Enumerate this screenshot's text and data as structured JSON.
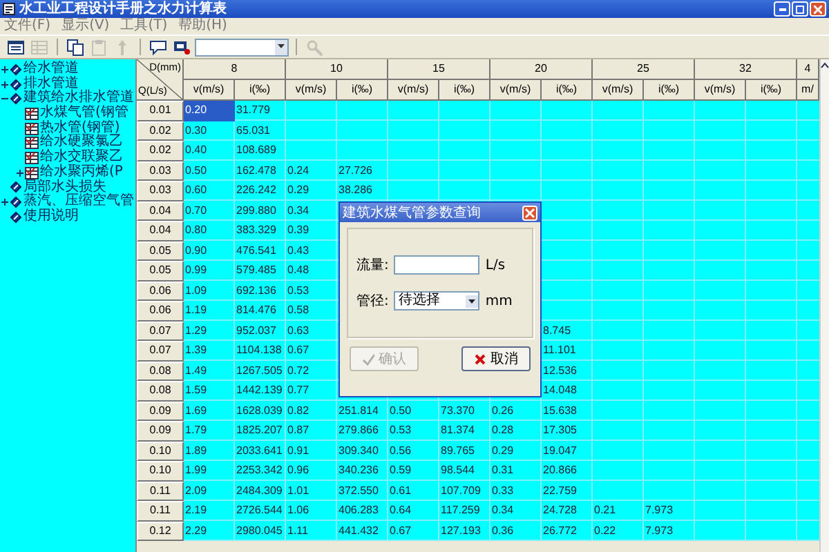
{
  "window": {
    "title": "水工业工程设计手册之水力计算表"
  },
  "menu": [
    {
      "label": "文件(F)"
    },
    {
      "label": "显示(V)"
    },
    {
      "label": "工具(T)"
    },
    {
      "label": "帮助(H)"
    }
  ],
  "toolbar": [
    {
      "kind": "view",
      "disabled": false
    },
    {
      "kind": "grid",
      "disabled": true
    },
    {
      "kind": "copy",
      "disabled": false
    },
    {
      "kind": "paste",
      "disabled": true
    },
    {
      "kind": "arrow",
      "disabled": true
    },
    {
      "kind": "bubble",
      "disabled": false
    },
    {
      "kind": "screen",
      "disabled": false
    },
    {
      "kind": "combo",
      "disabled": false
    },
    {
      "kind": "search",
      "disabled": true
    }
  ],
  "tree": [
    {
      "label": "给水管道",
      "expanded": false
    },
    {
      "label": "排水管道",
      "expanded": false
    },
    {
      "label": "建筑给水排水管道",
      "expanded": true,
      "children": [
        {
          "label": "水煤气管(钢管"
        },
        {
          "label": "热水管(钢管)"
        },
        {
          "label": "给水硬聚氯乙"
        },
        {
          "label": "给水交联聚乙"
        },
        {
          "label": "给水聚丙烯(P",
          "expanded": false
        }
      ]
    },
    {
      "label": "局部水头损失"
    },
    {
      "label": "蒸汽、压缩空气管",
      "expanded": false
    },
    {
      "label": "使用说明"
    }
  ],
  "table": {
    "corner": {
      "top": "D(mm)",
      "left": "Q(L/s)"
    },
    "column_groups": [
      {
        "diameter": "8",
        "sub": [
          "v(m/s)",
          "i(‰)"
        ]
      },
      {
        "diameter": "10",
        "sub": [
          "v(m/s)",
          "i(‰)"
        ]
      },
      {
        "diameter": "15",
        "sub": [
          "v(m/s)",
          "i(‰)"
        ]
      },
      {
        "diameter": "20",
        "sub": [
          "v(m/s)",
          "i(‰)"
        ]
      },
      {
        "diameter": "25",
        "sub": [
          "v(m/s)",
          "i(‰)"
        ]
      },
      {
        "diameter": "32",
        "sub": [
          "v(m/s)",
          "i(‰)"
        ]
      },
      {
        "diameter": "4",
        "sub": [
          "m/"
        ]
      }
    ],
    "rows": [
      {
        "q": "0.01",
        "selected": true,
        "cells": [
          "0.20",
          "31.779",
          "",
          "",
          "",
          "",
          "",
          "",
          "",
          "",
          "",
          "",
          ""
        ]
      },
      {
        "q": "0.02",
        "selected": false,
        "cells": [
          "0.30",
          "65.031",
          "",
          "",
          "",
          "",
          "",
          "",
          "",
          "",
          "",
          "",
          ""
        ]
      },
      {
        "q": "0.02",
        "selected": false,
        "cells": [
          "0.40",
          "108.689",
          "",
          "",
          "",
          "",
          "",
          "",
          "",
          "",
          "",
          "",
          ""
        ]
      },
      {
        "q": "0.03",
        "selected": false,
        "cells": [
          "0.50",
          "162.478",
          "0.24",
          "27.726",
          "",
          "",
          "",
          "",
          "",
          "",
          "",
          "",
          ""
        ]
      },
      {
        "q": "0.03",
        "selected": false,
        "cells": [
          "0.60",
          "226.242",
          "0.29",
          "38.286",
          "",
          "",
          "",
          "",
          "",
          "",
          "",
          "",
          ""
        ]
      },
      {
        "q": "0.04",
        "selected": false,
        "cells": [
          "0.70",
          "299.880",
          "0.34",
          "",
          "",
          "",
          "",
          "",
          "",
          "",
          "",
          "",
          ""
        ]
      },
      {
        "q": "0.04",
        "selected": false,
        "cells": [
          "0.80",
          "383.329",
          "0.39",
          "",
          "",
          "",
          "",
          "",
          "",
          "",
          "",
          "",
          ""
        ]
      },
      {
        "q": "0.05",
        "selected": false,
        "cells": [
          "0.90",
          "476.541",
          "0.43",
          "",
          "",
          "",
          "",
          "",
          "",
          "",
          "",
          "",
          ""
        ]
      },
      {
        "q": "0.05",
        "selected": false,
        "cells": [
          "0.99",
          "579.485",
          "0.48",
          "",
          "",
          "",
          "",
          "",
          "",
          "",
          "",
          "",
          ""
        ]
      },
      {
        "q": "0.06",
        "selected": false,
        "cells": [
          "1.09",
          "692.136",
          "0.53",
          "",
          "",
          "",
          "",
          "",
          "",
          "",
          "",
          "",
          ""
        ]
      },
      {
        "q": "0.06",
        "selected": false,
        "cells": [
          "1.19",
          "814.476",
          "0.58",
          "",
          "",
          "",
          "",
          "",
          "",
          "",
          "",
          "",
          ""
        ]
      },
      {
        "q": "0.07",
        "selected": false,
        "cells": [
          "1.29",
          "952.037",
          "0.63",
          "",
          "",
          "",
          "",
          "8.745",
          "",
          "",
          "",
          "",
          ""
        ]
      },
      {
        "q": "0.07",
        "selected": false,
        "cells": [
          "1.39",
          "1104.138",
          "0.67",
          "",
          "",
          "",
          "",
          "11.101",
          "",
          "",
          "",
          "",
          ""
        ]
      },
      {
        "q": "0.08",
        "selected": false,
        "cells": [
          "1.49",
          "1267.505",
          "0.72",
          "",
          "",
          "",
          "",
          "12.536",
          "",
          "",
          "",
          "",
          ""
        ]
      },
      {
        "q": "0.08",
        "selected": false,
        "cells": [
          "1.59",
          "1442.139",
          "0.77",
          "",
          "",
          "",
          "",
          "14.048",
          "",
          "",
          "",
          "",
          ""
        ]
      },
      {
        "q": "0.09",
        "selected": false,
        "cells": [
          "1.69",
          "1628.039",
          "0.82",
          "251.814",
          "0.50",
          "73.370",
          "0.26",
          "15.638",
          "",
          "",
          "",
          "",
          ""
        ]
      },
      {
        "q": "0.09",
        "selected": false,
        "cells": [
          "1.79",
          "1825.207",
          "0.87",
          "279.866",
          "0.53",
          "81.374",
          "0.28",
          "17.305",
          "",
          "",
          "",
          "",
          ""
        ]
      },
      {
        "q": "0.10",
        "selected": false,
        "cells": [
          "1.89",
          "2033.641",
          "0.91",
          "309.340",
          "0.56",
          "89.765",
          "0.29",
          "19.047",
          "",
          "",
          "",
          "",
          ""
        ]
      },
      {
        "q": "0.10",
        "selected": false,
        "cells": [
          "1.99",
          "2253.342",
          "0.96",
          "340.236",
          "0.59",
          "98.544",
          "0.31",
          "20.866",
          "",
          "",
          "",
          "",
          ""
        ]
      },
      {
        "q": "0.11",
        "selected": false,
        "cells": [
          "2.09",
          "2484.309",
          "1.01",
          "372.550",
          "0.61",
          "107.709",
          "0.33",
          "22.759",
          "",
          "",
          "",
          "",
          ""
        ]
      },
      {
        "q": "0.11",
        "selected": false,
        "cells": [
          "2.19",
          "2726.544",
          "1.06",
          "406.283",
          "0.64",
          "117.259",
          "0.34",
          "24.728",
          "0.21",
          "7.973",
          "",
          "",
          ""
        ]
      },
      {
        "q": "0.12",
        "selected": false,
        "cells": [
          "2.29",
          "2980.045",
          "1.11",
          "441.432",
          "0.67",
          "127.193",
          "0.36",
          "26.772",
          "0.22",
          "7.973",
          "",
          "",
          ""
        ]
      }
    ]
  },
  "dialog": {
    "title": "建筑水煤气管参数查询",
    "fields": [
      {
        "kind": "input",
        "label": "流量:",
        "unit": "L/s"
      },
      {
        "kind": "select",
        "label": "管径:",
        "value": "待选择",
        "unit": "mm"
      }
    ],
    "buttons": [
      {
        "kind": "confirm",
        "label": "确认",
        "disabled": true
      },
      {
        "kind": "cancel",
        "label": "取消",
        "disabled": false
      }
    ]
  }
}
